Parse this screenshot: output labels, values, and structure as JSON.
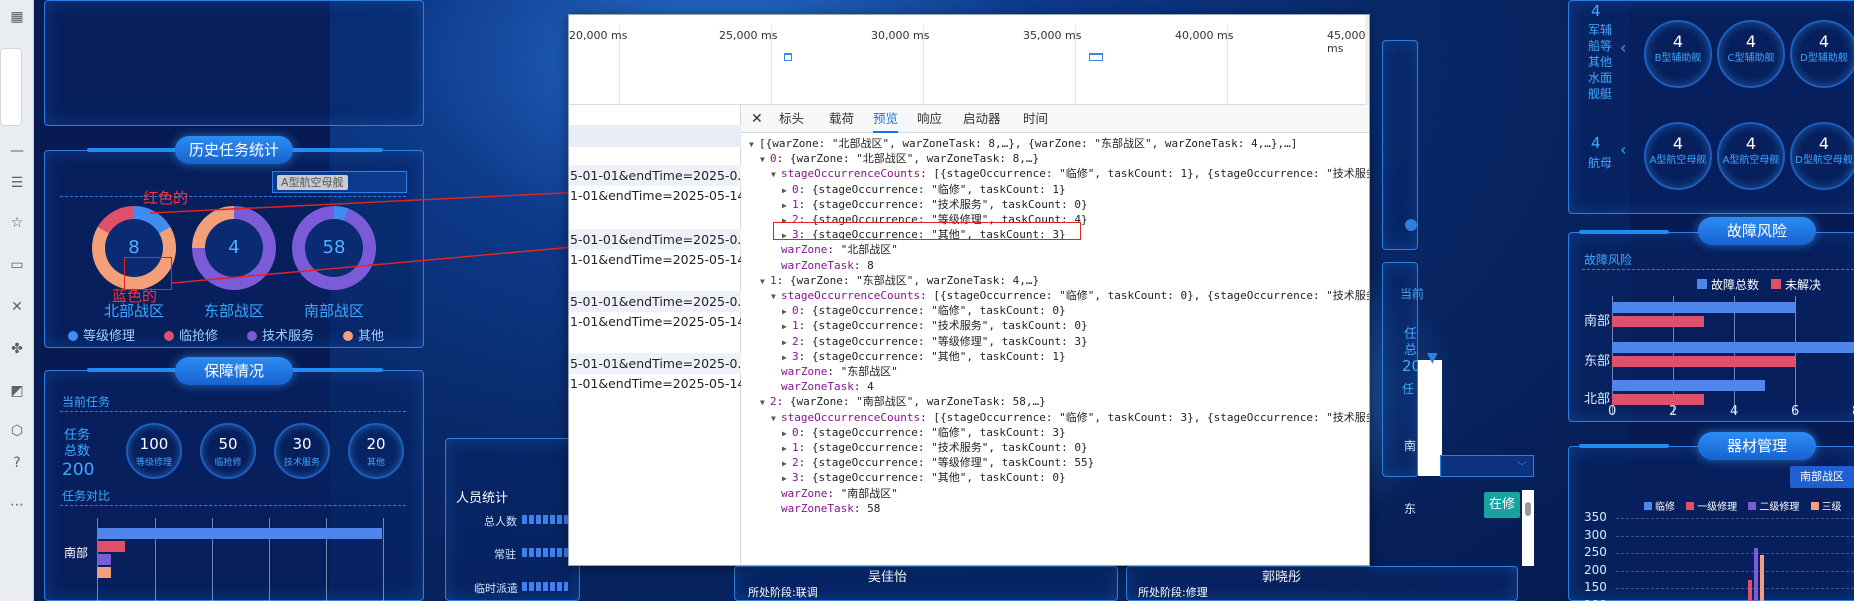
{
  "left_rail": {
    "icons": [
      "grid-icon",
      "sliders-icon",
      "star-icon",
      "monitor-icon",
      "tools-icon",
      "puzzle-icon",
      "chart-icon",
      "cube-icon",
      "help-icon",
      "more-icon"
    ]
  },
  "history": {
    "title": "历史任务统计",
    "select_placeholder": "A型航空母舰",
    "donuts": [
      {
        "label": "北部战区",
        "value": "8"
      },
      {
        "label": "东部战区",
        "value": "4"
      },
      {
        "label": "南部战区",
        "value": "58"
      }
    ],
    "legend": [
      {
        "label": "等级修理",
        "color": "#3f8cf2"
      },
      {
        "label": "临抢修",
        "color": "#e0506a"
      },
      {
        "label": "技术服务",
        "color": "#7b5bd8"
      },
      {
        "label": "其他",
        "color": "#f3a07a"
      }
    ],
    "annotations": {
      "red": "红色的",
      "blue": "蓝色的"
    }
  },
  "guarantee": {
    "title": "保障情况",
    "current_tasks": "当前任务",
    "total_label": "任务\n总数",
    "total_value": "200",
    "stats": [
      {
        "value": "100",
        "label": "等级修理"
      },
      {
        "value": "50",
        "label": "临抢修"
      },
      {
        "value": "30",
        "label": "技术服务"
      },
      {
        "value": "20",
        "label": "其他"
      }
    ],
    "compare_label": "任务对比",
    "south": "南部"
  },
  "personnel": {
    "title": "人员统计",
    "rows": [
      "总人数",
      "常驻",
      "临时派遣"
    ]
  },
  "bottom": {
    "person1": "吴佳怡",
    "stage1": "所处阶段:联调",
    "person2": "郭晓彤",
    "stage2": "所处阶段:修理"
  },
  "devtools": {
    "ticks": [
      "20,000 ms",
      "25,000 ms",
      "30,000 ms",
      "35,000 ms",
      "40,000 ms",
      "45,000 ms"
    ],
    "requests": [
      "5-01-01&endTime=2025-0...",
      "1-01&endTime=2025-05-14",
      "5-01-01&endTime=2025-0...",
      "1-01&endTime=2025-05-14",
      "5-01-01&endTime=2025-0...",
      "1-01&endTime=2025-05-14",
      "5-01-01&endTime=2025-0...",
      "1-01&endTime=2025-05-14"
    ],
    "close": "✕",
    "tabs": [
      "标头",
      "载荷",
      "预览",
      "响应",
      "启动器",
      "时间"
    ],
    "active_tab": "预览",
    "json_lines": [
      "[{warZone: \"北部战区\", warZoneTask: 8,…}, {warZone: \"东部战区\", warZoneTask: 4,…},…]",
      "0: {warZone: \"北部战区\", warZoneTask: 8,…}",
      "stageOccurrenceCounts: [{stageOccurrence: \"临修\", taskCount: 1}, {stageOccurrence: \"技术服务\", taskC",
      "0: {stageOccurrence: \"临修\", taskCount: 1}",
      "1: {stageOccurrence: \"技术服务\", taskCount: 0}",
      "2: {stageOccurrence: \"等级修理\", taskCount: 4}",
      "3: {stageOccurrence: \"其他\", taskCount: 3}",
      "warZone: \"北部战区\"",
      "warZoneTask: 8",
      "1: {warZone: \"东部战区\", warZoneTask: 4,…}",
      "stageOccurrenceCounts: [{stageOccurrence: \"临修\", taskCount: 0}, {stageOccurrence: \"技术服务\", taskC",
      "0: {stageOccurrence: \"临修\", taskCount: 0}",
      "1: {stageOccurrence: \"技术服务\", taskCount: 0}",
      "2: {stageOccurrence: \"等级修理\", taskCount: 3}",
      "3: {stageOccurrence: \"其他\", taskCount: 1}",
      "warZone: \"东部战区\"",
      "warZoneTask: 4",
      "2: {warZone: \"南部战区\", warZoneTask: 58,…}",
      "stageOccurrenceCounts: [{stageOccurrence: \"临修\", taskCount: 3}, {stageOccurrence: \"技术服务\", taskC",
      "0: {stageOccurrence: \"临修\", taskCount: 3}",
      "1: {stageOccurrence: \"技术服务\", taskCount: 0}",
      "2: {stageOccurrence: \"等级修理\", taskCount: 55}",
      "3: {stageOccurrence: \"其他\", taskCount: 0}",
      "warZone: \"南部战区\"",
      "warZoneTask: 58"
    ]
  },
  "right_top": {
    "group1_count": "4",
    "group1_label": "军辅\n船等\n其他\n水面\n舰艇",
    "group1_items": [
      "B型辅助舰",
      "C型辅助舰",
      "D型辅助舰"
    ],
    "group2_count": "4",
    "group2_label": "航母",
    "group2_items": [
      "A型航空母舰",
      "A型航空母舰",
      "D型航空母舰"
    ],
    "item_value": "4"
  },
  "fault": {
    "title": "故障风险",
    "subtitle": "故障风险",
    "legend": [
      {
        "label": "故障总数",
        "color": "#4f86ec"
      },
      {
        "label": "未解决",
        "color": "#e0506a"
      }
    ],
    "chart_data": {
      "type": "bar",
      "orientation": "horizontal",
      "categories": [
        "南部",
        "东部",
        "北部"
      ],
      "series": [
        {
          "name": "故障总数",
          "values": [
            6,
            8.5,
            5
          ]
        },
        {
          "name": "未解决",
          "values": [
            3,
            6,
            3
          ]
        }
      ],
      "xticks": [
        "0",
        "2",
        "4",
        "6",
        "8"
      ],
      "xlim": [
        0,
        8
      ]
    }
  },
  "equipment": {
    "title": "器材管理",
    "filter": "南部战区",
    "legend": [
      {
        "label": "临修",
        "color": "#4f86ec"
      },
      {
        "label": "一级修理",
        "color": "#e0506a"
      },
      {
        "label": "二级修理",
        "color": "#7b5bd8"
      },
      {
        "label": "三级",
        "color": "#f3a07a"
      }
    ],
    "chart_data": {
      "type": "bar",
      "yticks": [
        "350",
        "300",
        "250",
        "200",
        "150",
        "100"
      ]
    }
  },
  "mid_right": {
    "current": "当前",
    "task": "任",
    "total": "总",
    "num": "20",
    "task2": "任",
    "south": "南",
    "east": "东",
    "status": "在修"
  }
}
